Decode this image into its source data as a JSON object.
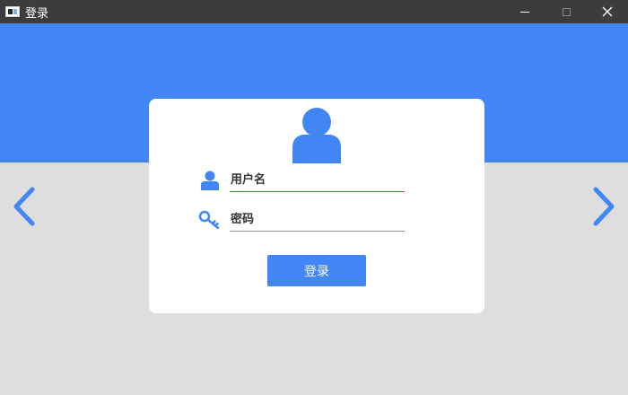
{
  "window": {
    "title": "登录",
    "controls": {
      "minimize": "minimize",
      "maximize": "maximize",
      "close": "close"
    }
  },
  "colors": {
    "accent": "#4285f4",
    "background": "#dedede",
    "titlebar": "#3c3c3c",
    "card": "#ffffff",
    "username_underline": "#c0392b",
    "password_underline": "#8e8e8e"
  },
  "login": {
    "username": {
      "icon": "user-icon",
      "placeholder": "用户名",
      "value": ""
    },
    "password": {
      "icon": "key-icon",
      "placeholder": "密码",
      "value": ""
    },
    "submit_label": "登录"
  },
  "nav": {
    "prev_icon": "chevron-left-icon",
    "next_icon": "chevron-right-icon"
  }
}
